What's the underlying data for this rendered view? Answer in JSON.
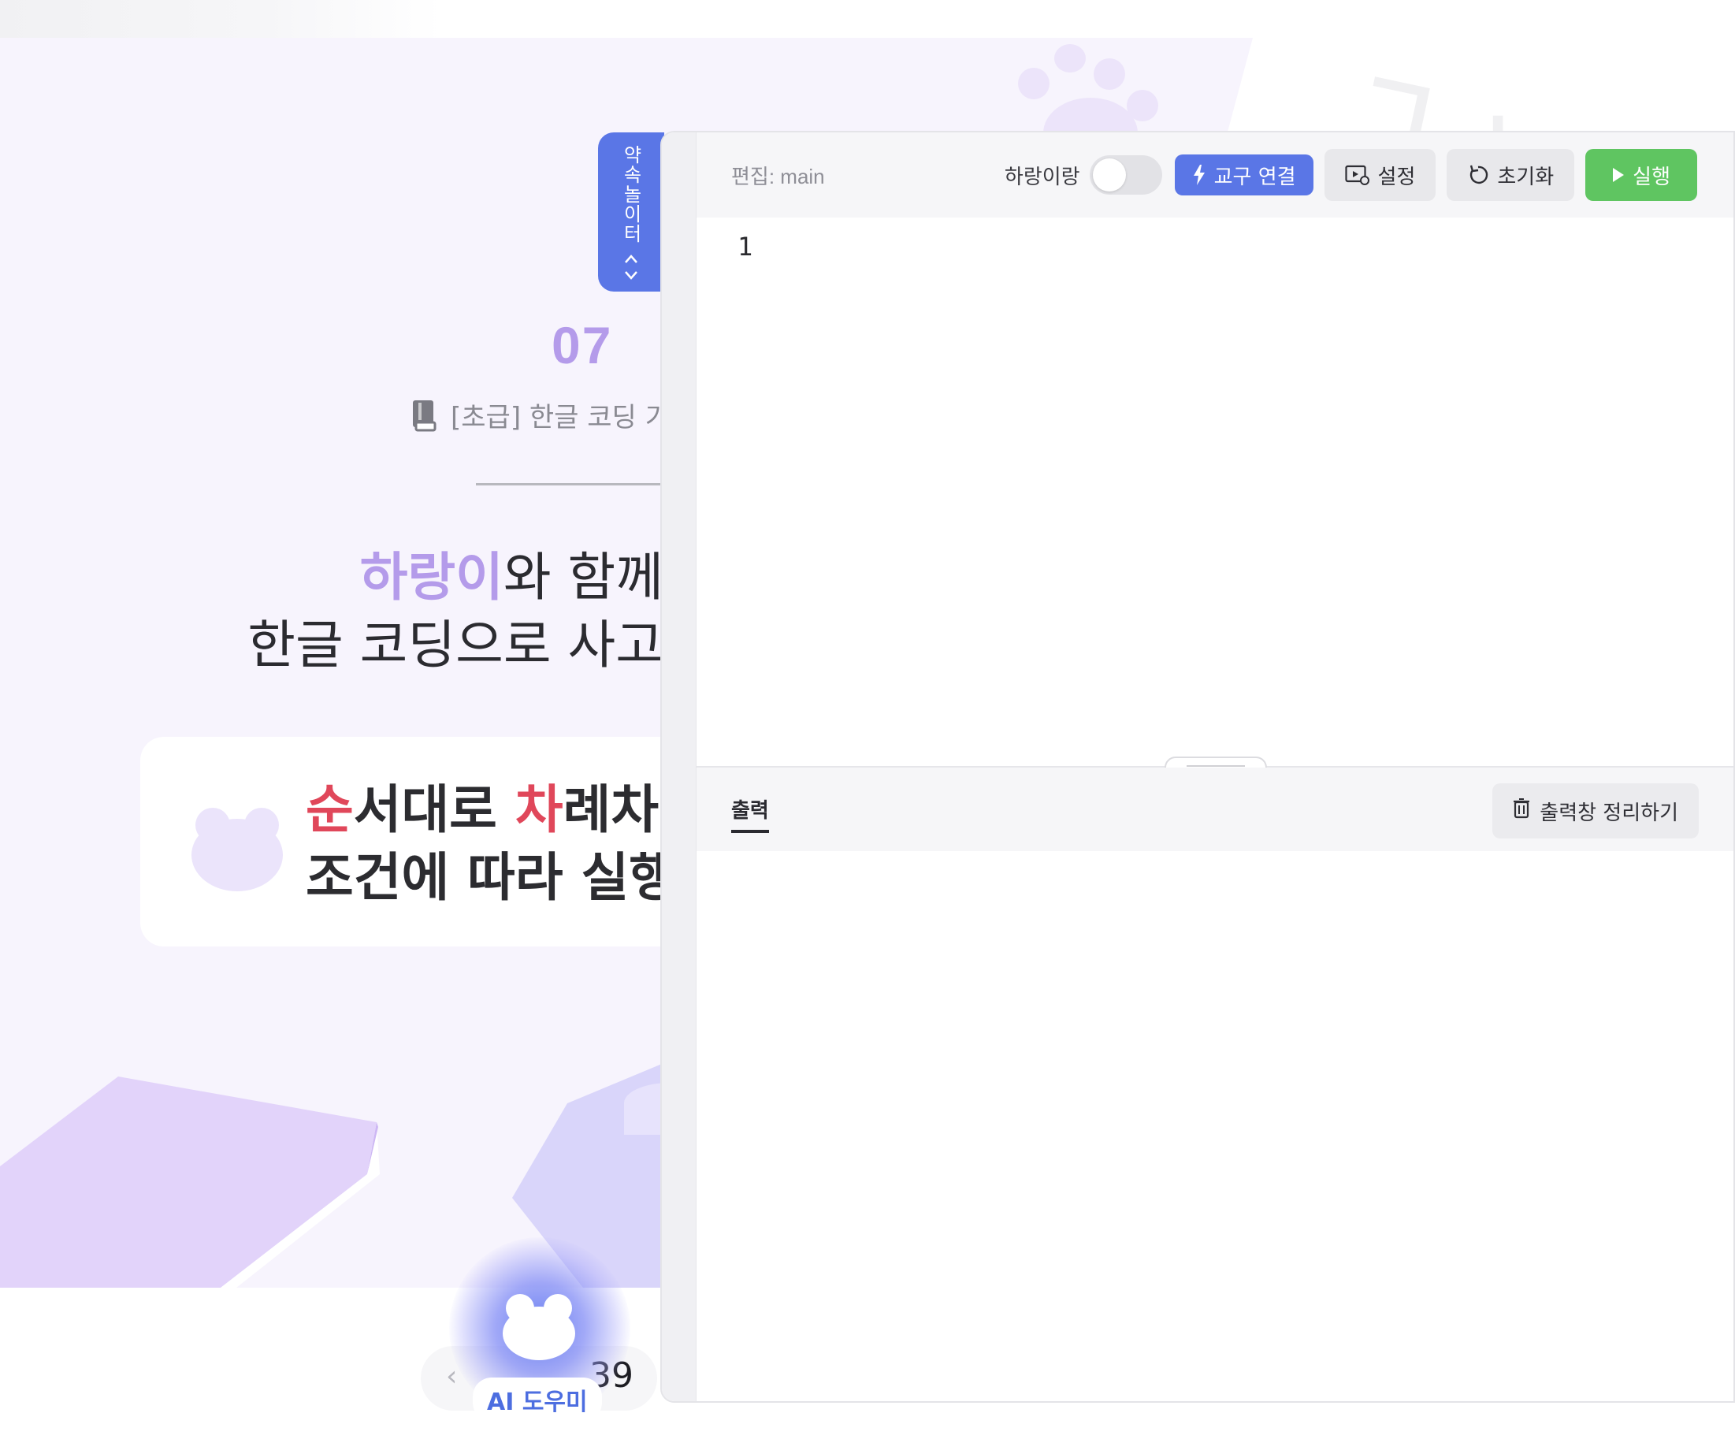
{
  "side_tab": {
    "label": "약속놀이터"
  },
  "lesson": {
    "number": "07",
    "title": "[초급] 한글 코딩 기"
  },
  "headline": {
    "line1_highlight": "하랑이",
    "line1_rest": "와 함께",
    "line2": "한글 코딩으로 사고"
  },
  "card": {
    "line1_red1": "순",
    "line1_mid": "서대로 ",
    "line1_red2": "차",
    "line1_rest": "례차례",
    "line2": "조건에 따라 실행"
  },
  "pager": {
    "prev_icon": "chevron-left-icon",
    "page_fragment": "39"
  },
  "ai_helper": {
    "label": "AI 도우미"
  },
  "editor": {
    "title": "편집: main",
    "toggle_label": "하랑이랑",
    "toggle_on": false,
    "connect_button": "교구 연결",
    "settings_button": "설정",
    "reset_button": "초기화",
    "run_button": "실행",
    "line_numbers": [
      "1"
    ]
  },
  "output": {
    "tab_label": "출력",
    "clear_button": "출력창 정리하기"
  },
  "colors": {
    "accent_blue": "#5a76e6",
    "run_green": "#5fc561",
    "highlight_purple": "#b49bea",
    "highlight_red": "#e0475a",
    "page_background": "#f7f4fd"
  }
}
